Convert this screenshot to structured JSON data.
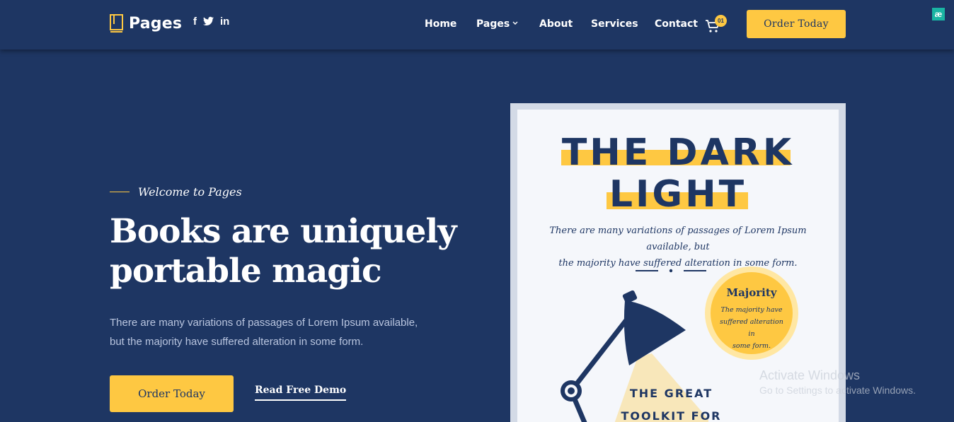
{
  "header": {
    "logo_text": "Pages",
    "social": [
      "f",
      "twitter-icon",
      "in"
    ],
    "nav": [
      {
        "label": "Home"
      },
      {
        "label": "Pages"
      },
      {
        "label": "About"
      },
      {
        "label": "Services"
      },
      {
        "label": "Contact"
      }
    ],
    "cart_count": "01",
    "order_label": "Order Today",
    "extension_icon": "æ"
  },
  "hero": {
    "eyebrow": "Welcome to Pages",
    "title_line1": "Books are uniquely",
    "title_line2": "portable magic",
    "desc_line1": "There are many variations of passages of Lorem Ipsum available,",
    "desc_line2": "but the majority have suffered alteration in some form.",
    "order_button": "Order Today",
    "demo_link": "Read Free Demo"
  },
  "book": {
    "title_line1": "THE DARK",
    "title_line2": "LIGHT",
    "desc_line1": "There are many variations of passages of Lorem Ipsum available, but",
    "desc_line2": "the majority have suffered alteration in some form.",
    "badge_title": "Majority",
    "badge_line1": "The majority have",
    "badge_line2": "suffered alteration in",
    "badge_line3": "some form.",
    "sub_line1": "THE GREAT",
    "sub_line2": "TOOLKIT FOR"
  },
  "watermark": {
    "title": "Activate Windows",
    "subtitle": "Go to Settings to activate Windows."
  },
  "colors": {
    "background": "#1e3663",
    "accent": "#fec842",
    "cover": "#f5f7fb"
  }
}
